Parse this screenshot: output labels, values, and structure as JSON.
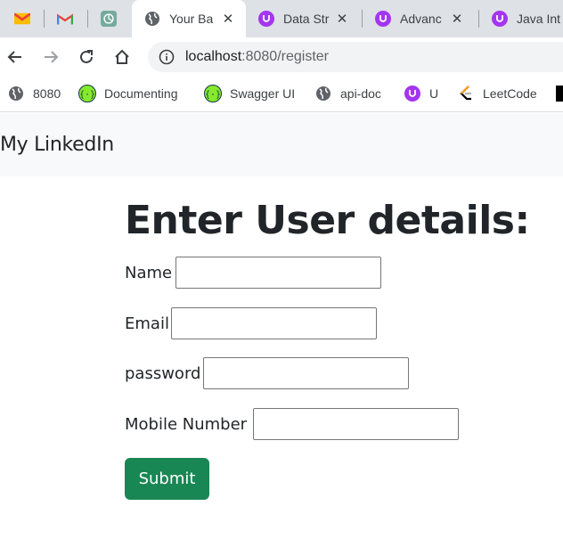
{
  "browser": {
    "tabs": [
      {
        "title": "",
        "icon": "mail-icon"
      },
      {
        "title": "",
        "icon": "gmail-icon"
      },
      {
        "title": "",
        "icon": "chatgpt-icon"
      },
      {
        "title": "Your Ba",
        "icon": "globe-icon",
        "active": true
      },
      {
        "title": "Data Str",
        "icon": "udemy-icon"
      },
      {
        "title": "Advanc",
        "icon": "udemy-icon"
      },
      {
        "title": "Java Int",
        "icon": "udemy-icon"
      }
    ],
    "url_host": "localhost",
    "url_rest": ":8080/register",
    "bookmarks": [
      {
        "label": "8080",
        "icon": "globe-icon"
      },
      {
        "label": "Documenting",
        "icon": "swagger-icon"
      },
      {
        "label": "Swagger UI",
        "icon": "swagger-icon"
      },
      {
        "label": "api-doc",
        "icon": "globe-icon"
      },
      {
        "label": "U",
        "icon": "udemy-icon"
      },
      {
        "label": "LeetCode",
        "icon": "leetcode-icon"
      }
    ],
    "colors": {
      "tabstrip": "#dee1e6",
      "udemy": "#a435f0",
      "swagger": "#85ea2d",
      "submit": "#198754"
    }
  },
  "page": {
    "brand": "My LinkedIn",
    "heading": "Enter User details:",
    "fields": {
      "name_label": "Name",
      "email_label": "Email",
      "password_label": "password",
      "mobile_label": "Mobile Number"
    },
    "submit_label": "Submit"
  }
}
